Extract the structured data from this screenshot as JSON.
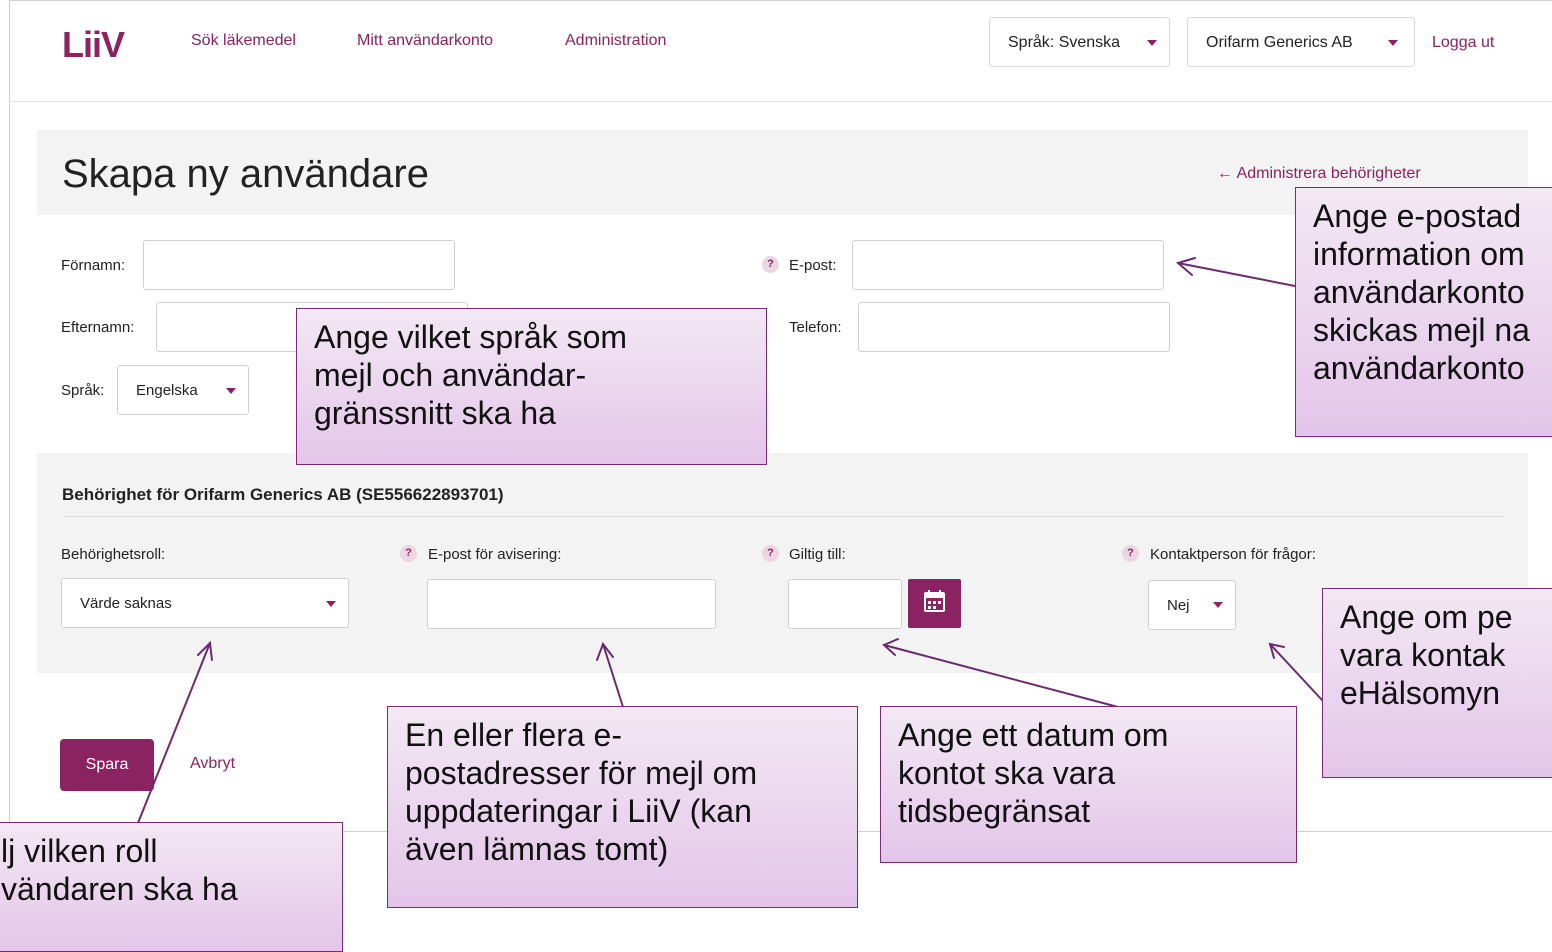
{
  "header": {
    "logo": "LiiV",
    "nav": [
      "Sök läkemedel",
      "Mitt användarkonto",
      "Administration"
    ],
    "language_dropdown": "Språk: Svenska",
    "org_dropdown": "Orifarm Generics AB",
    "logout": "Logga ut"
  },
  "page": {
    "title": "Skapa ny användare",
    "back_link": "← Administrera behörigheter"
  },
  "form": {
    "first_name_label": "Förnamn:",
    "last_name_label": "Efternamn:",
    "language_label": "Språk:",
    "language_value": "Engelska",
    "email_label": "E-post:",
    "phone_label": "Telefon:",
    "help_mark": "?"
  },
  "permissions": {
    "title": "Behörighet för Orifarm Generics AB (SE556622893701)",
    "role_label": "Behörighetsroll:",
    "role_value": "Värde saknas",
    "notify_email_label": "E-post för avisering:",
    "valid_until_label": "Giltig till:",
    "contact_label": "Kontaktperson för frågor:",
    "contact_value": "Nej"
  },
  "actions": {
    "save": "Spara",
    "cancel": "Avbryt"
  },
  "callouts": {
    "language": "Ange vilket språk som\nmejl och användar-\ngränssnitt ska ha",
    "email": "Ange e-postad\ninformation om\nanvändarkonto\nskickas mejl na\nanvändarkonto",
    "contact": "Ange om pe\nvara kontak\neHälsomyn",
    "role": "lj vilken roll\nvändaren ska ha",
    "notify": "En eller flera e-\npostadresser för mejl om\nuppdateringar i LiiV (kan\näven lämnas tomt)",
    "date": "Ange ett datum om\nkontot ska vara\ntidsbegränsat"
  },
  "colors": {
    "brand": "#8b2261",
    "callout_border": "#7b2a78",
    "section_bg": "#f3f3f4"
  }
}
